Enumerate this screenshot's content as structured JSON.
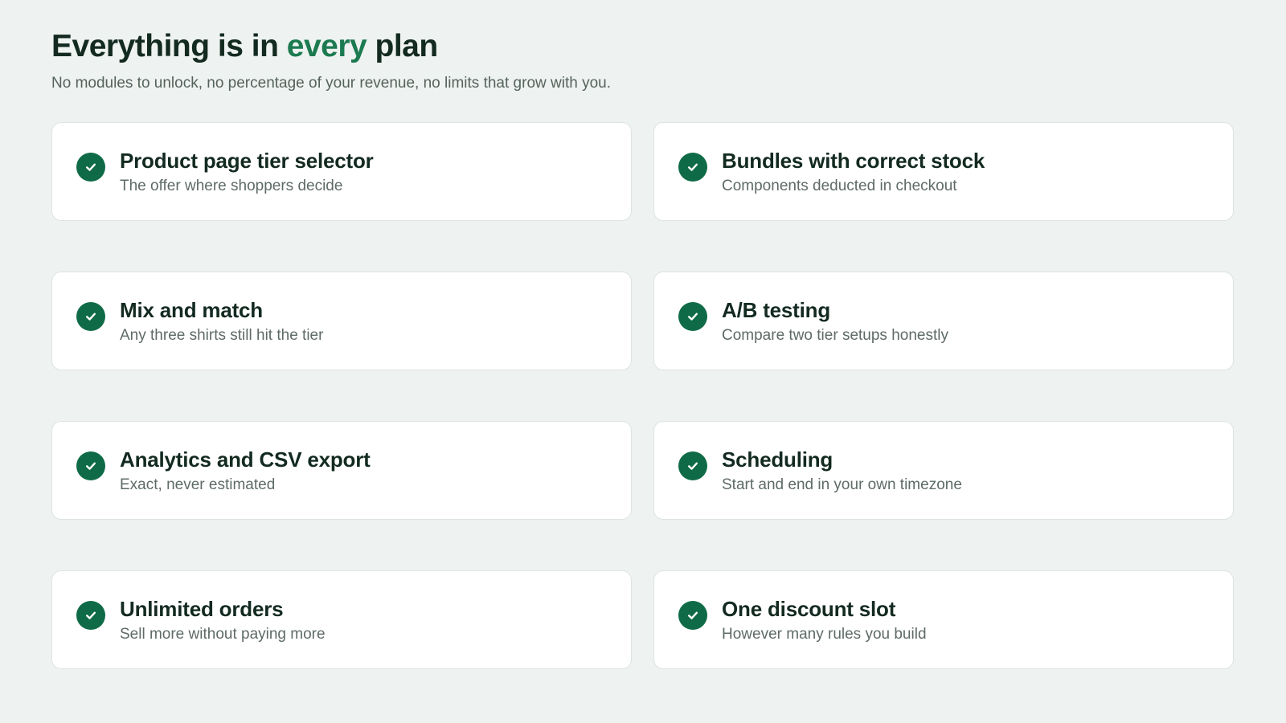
{
  "header": {
    "title_before": "Everything is in ",
    "title_accent": "every",
    "title_after": " plan",
    "subtitle": "No modules to unlock, no percentage of your revenue, no limits that grow with you."
  },
  "features": [
    {
      "title": "Product page tier selector",
      "description": "The offer where shoppers decide",
      "icon": "check-circle-icon"
    },
    {
      "title": "Bundles with correct stock",
      "description": "Components deducted in checkout",
      "icon": "check-circle-icon"
    },
    {
      "title": "Mix and match",
      "description": "Any three shirts still hit the tier",
      "icon": "check-circle-icon"
    },
    {
      "title": "A/B testing",
      "description": "Compare two tier setups honestly",
      "icon": "check-circle-icon"
    },
    {
      "title": "Analytics and CSV export",
      "description": "Exact, never estimated",
      "icon": "check-circle-icon"
    },
    {
      "title": "Scheduling",
      "description": "Start and end in your own timezone",
      "icon": "check-circle-icon"
    },
    {
      "title": "Unlimited orders",
      "description": "Sell more without paying more",
      "icon": "check-circle-icon"
    },
    {
      "title": "One discount slot",
      "description": "However many rules you build",
      "icon": "check-circle-icon"
    }
  ],
  "colors": {
    "accent": "#1b7a50",
    "check_background": "#0f6b47",
    "page_background": "#eef2f0",
    "card_background": "#ffffff"
  }
}
